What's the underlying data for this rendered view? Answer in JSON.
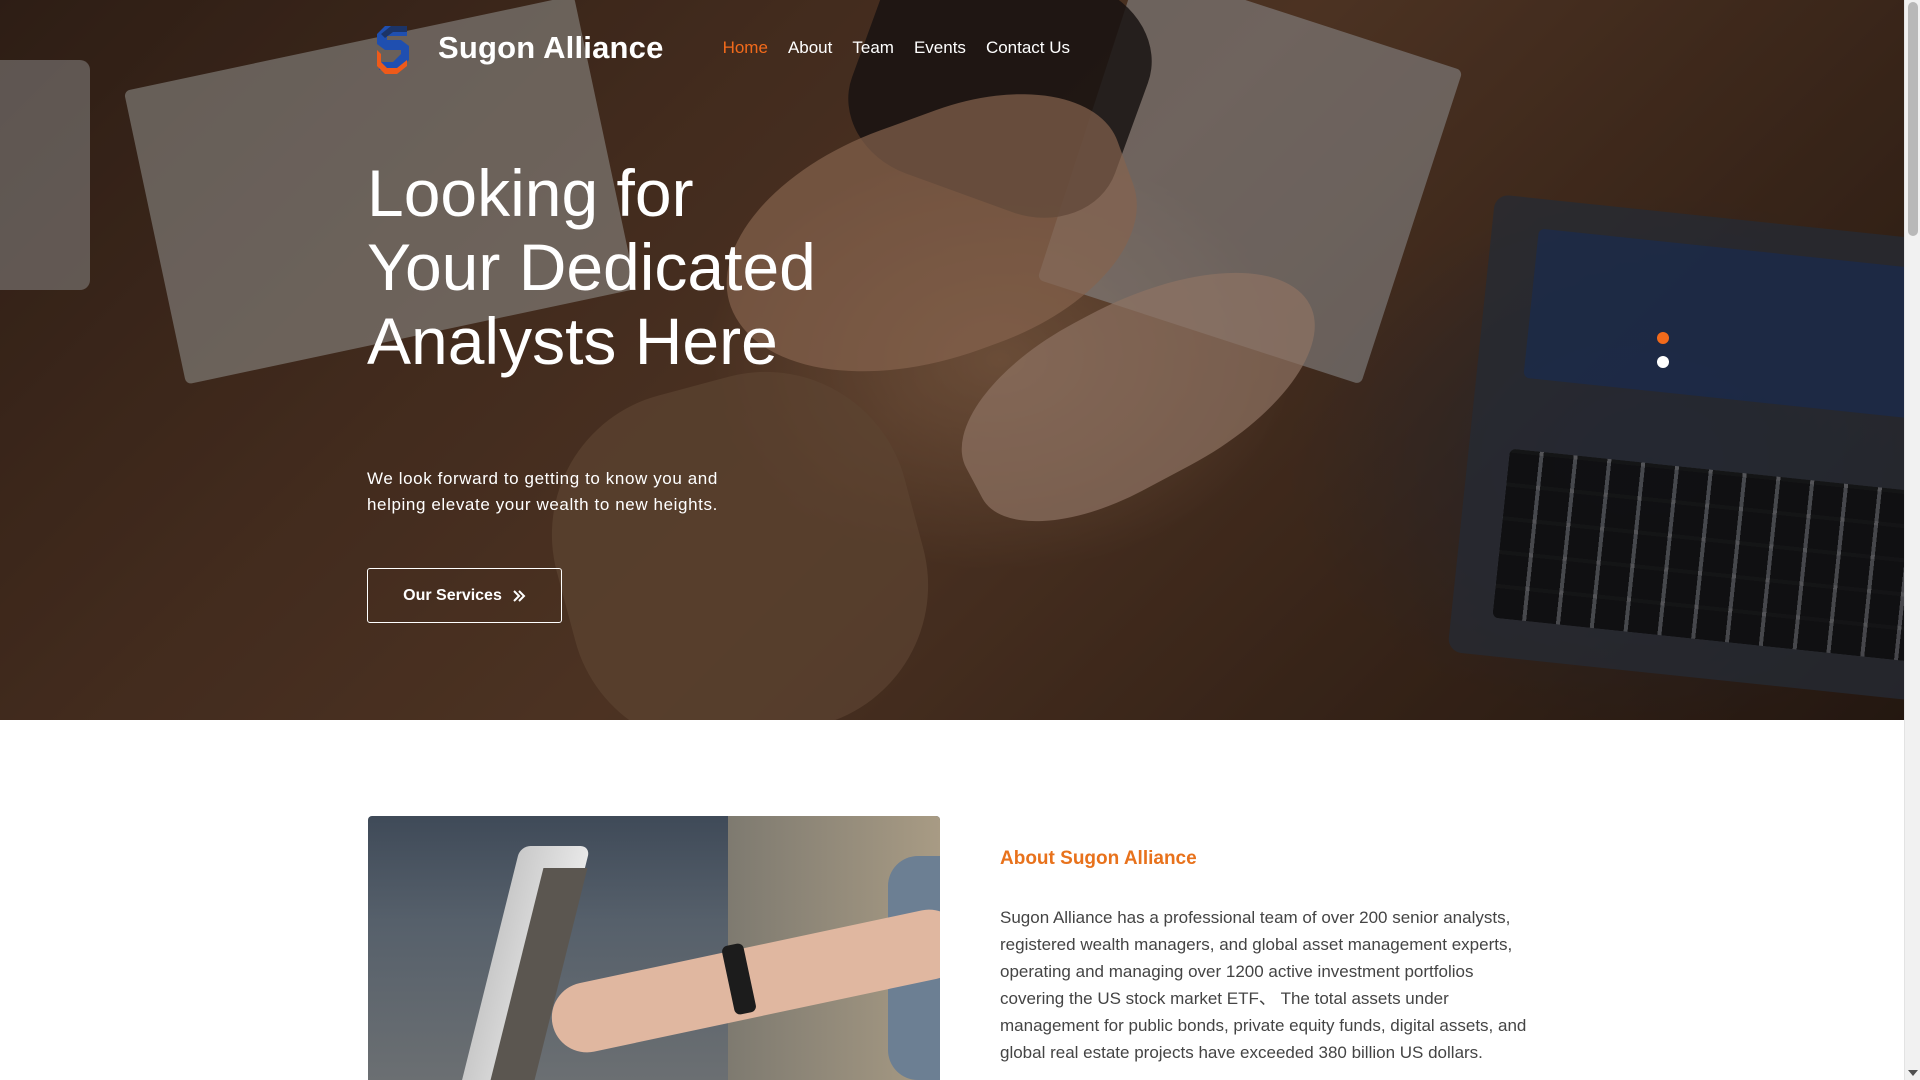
{
  "brand": {
    "name": "Sugon Alliance",
    "logo_icon": "sugon-s-logo-icon"
  },
  "nav": {
    "items": [
      {
        "label": "Home",
        "active": true
      },
      {
        "label": "About",
        "active": false
      },
      {
        "label": "Team",
        "active": false
      },
      {
        "label": "Events",
        "active": false
      },
      {
        "label": "Contact Us",
        "active": false
      }
    ]
  },
  "hero": {
    "title": "Looking for Your Dedicated Analysts Here",
    "subtitle": "We look forward to getting to know you and helping elevate your wealth to new heights.",
    "button_label": "Our Services",
    "button_icon": "double-chevron-right-icon",
    "slides": {
      "count": 2,
      "active_index": 0
    }
  },
  "about": {
    "heading": "About Sugon Alliance",
    "text": "Sugon Alliance has a professional team of over 200 senior analysts, registered wealth managers, and global asset management experts, operating and managing over 1200 active investment portfolios covering the US stock market ETF、 The total assets under management for public bonds, private equity funds, digital assets, and global real estate projects have exceeded 380 billion US dollars."
  },
  "colors": {
    "accent": "#f26a1b",
    "about_heading": "#e8721c",
    "body_text": "#444444"
  }
}
